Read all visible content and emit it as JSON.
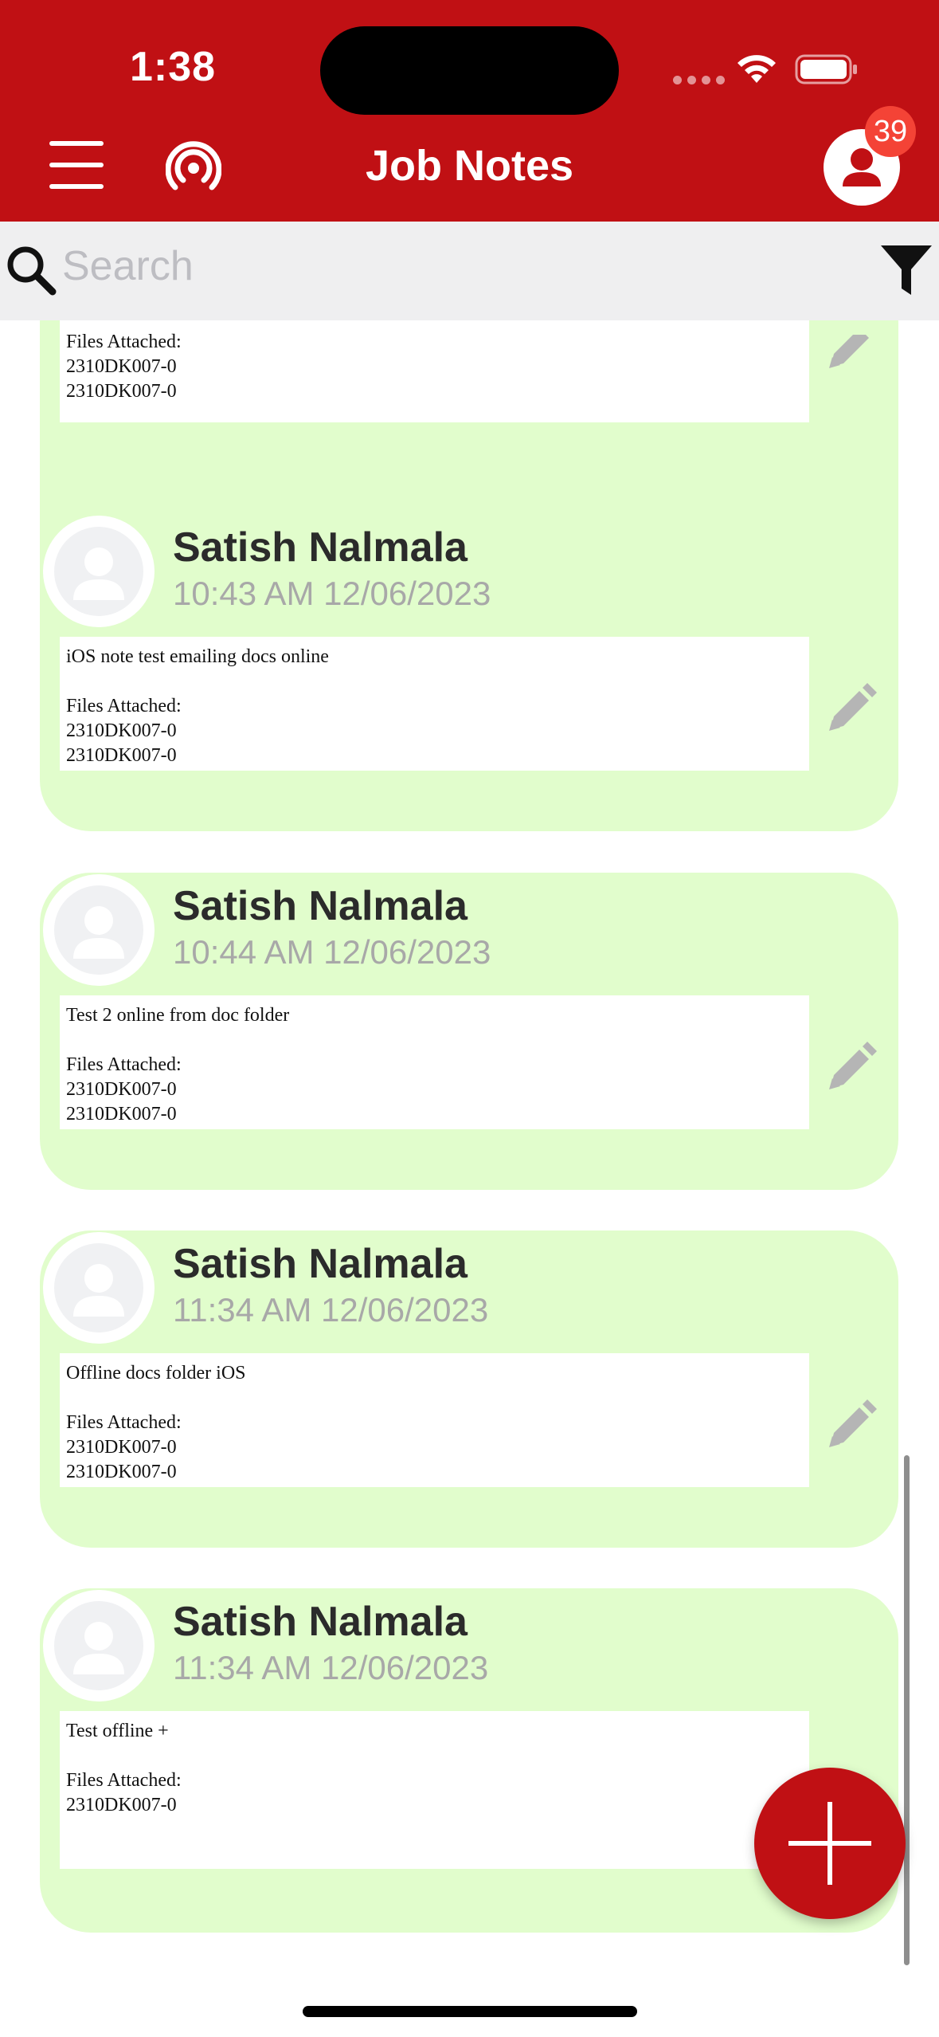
{
  "status_bar": {
    "time": "1:38"
  },
  "header": {
    "title": "Job Notes",
    "notification_count": "39"
  },
  "search": {
    "placeholder": "Search"
  },
  "notes_partial_top": {
    "lines": [
      "Files Attached:",
      "2310DK007-0",
      "2310DK007-0"
    ]
  },
  "notes": [
    {
      "author": "Satish Nalmala",
      "timestamp": "10:43 AM 12/06/2023",
      "text": "iOS note test emailing docs online",
      "files_label": "Files Attached:",
      "files": [
        "2310DK007-0",
        "2310DK007-0"
      ]
    },
    {
      "author": "Satish Nalmala",
      "timestamp": "10:44 AM 12/06/2023",
      "text": "Test 2 online from doc folder",
      "files_label": "Files Attached:",
      "files": [
        "2310DK007-0",
        "2310DK007-0"
      ]
    },
    {
      "author": "Satish Nalmala",
      "timestamp": "11:34 AM 12/06/2023",
      "text": "Offline docs folder iOS",
      "files_label": "Files Attached:",
      "files": [
        "2310DK007-0",
        "2310DK007-0"
      ]
    },
    {
      "author": "Satish Nalmala",
      "timestamp": "11:34 AM 12/06/2023",
      "text": "Test offline +",
      "files_label": "Files Attached:",
      "files": [
        "2310DK007-0"
      ]
    }
  ],
  "colors": {
    "brand_red": "#c01014",
    "card_green": "#e1fdcc",
    "badge_red": "#f44336"
  },
  "icons": [
    "menu-icon",
    "broadcast-icon",
    "profile-icon",
    "search-icon",
    "filter-icon",
    "pencil-icon",
    "plus-icon"
  ]
}
